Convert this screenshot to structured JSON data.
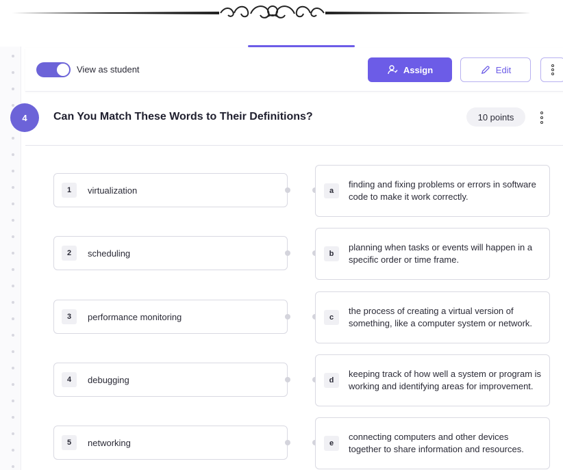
{
  "toolbar": {
    "view_as_student_label": "View as student",
    "view_as_student_on": true,
    "assign_label": "Assign",
    "edit_label": "Edit"
  },
  "question": {
    "number": "4",
    "title": "Can You Match These Words to Their Definitions?",
    "points": "10 points"
  },
  "terms": [
    {
      "num": "1",
      "text": "virtualization"
    },
    {
      "num": "2",
      "text": "scheduling"
    },
    {
      "num": "3",
      "text": "performance monitoring"
    },
    {
      "num": "4",
      "text": "debugging"
    },
    {
      "num": "5",
      "text": "networking"
    }
  ],
  "definitions": [
    {
      "letter": "a",
      "text": "finding and fixing problems or errors in software code to make it work correctly."
    },
    {
      "letter": "b",
      "text": "planning when tasks or events will happen in a specific order or time frame."
    },
    {
      "letter": "c",
      "text": "the process of creating a virtual version of something, like a computer system or network."
    },
    {
      "letter": "d",
      "text": "keeping track of how well a system or program is working and identifying areas for improvement."
    },
    {
      "letter": "e",
      "text": "connecting computers and other devices together to share information and resources."
    }
  ],
  "colors": {
    "accent": "#6c5ce7",
    "accent_light": "#b7b0f0"
  }
}
